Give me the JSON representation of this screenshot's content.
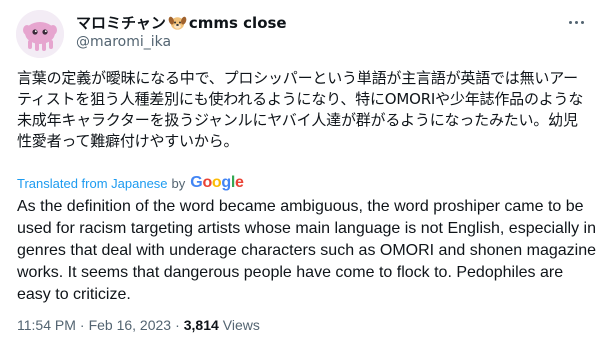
{
  "author": {
    "display_name": "マロミチャン",
    "name_suffix": "cmms close",
    "handle": "@maromi_ika",
    "name_emoji": "dog-face-emoji"
  },
  "menu": {
    "icon": "more-horizontal-icon"
  },
  "tweet": {
    "original_text": "言葉の定義が曖昧になる中で、プロシッパーという単語が主言語が英語では無いアーティストを狙う人種差別にも使われるようになり、特にOMORIや少年誌作品のような未成年キャラクターを扱うジャンルにヤバイ人達が群がるようになったみたい。幼児性愛者って難癖付けやすいから。",
    "translated_from_label": "Translated from Japanese",
    "by_label": "by",
    "google_label": "Google",
    "translated_text": "As the definition of the word became ambiguous, the word proshiper came to be used for racism targeting artists whose main language is not English, especially in genres that deal with underage characters such as OMORI and shonen magazine works. It seems that dangerous people have come to flock to. Pedophiles are easy to criticize."
  },
  "meta": {
    "time": "11:54 PM",
    "separator": "·",
    "date": "Feb 16, 2023",
    "separator2": "·",
    "views_count": "3,814",
    "views_label": "Views"
  },
  "colors": {
    "link": "#1d9bf0",
    "secondary_text": "#536471",
    "primary_text": "#0f1419",
    "google_blue": "#4285f4",
    "google_red": "#ea4335",
    "google_yellow": "#fbbc05",
    "google_green": "#34a853"
  }
}
